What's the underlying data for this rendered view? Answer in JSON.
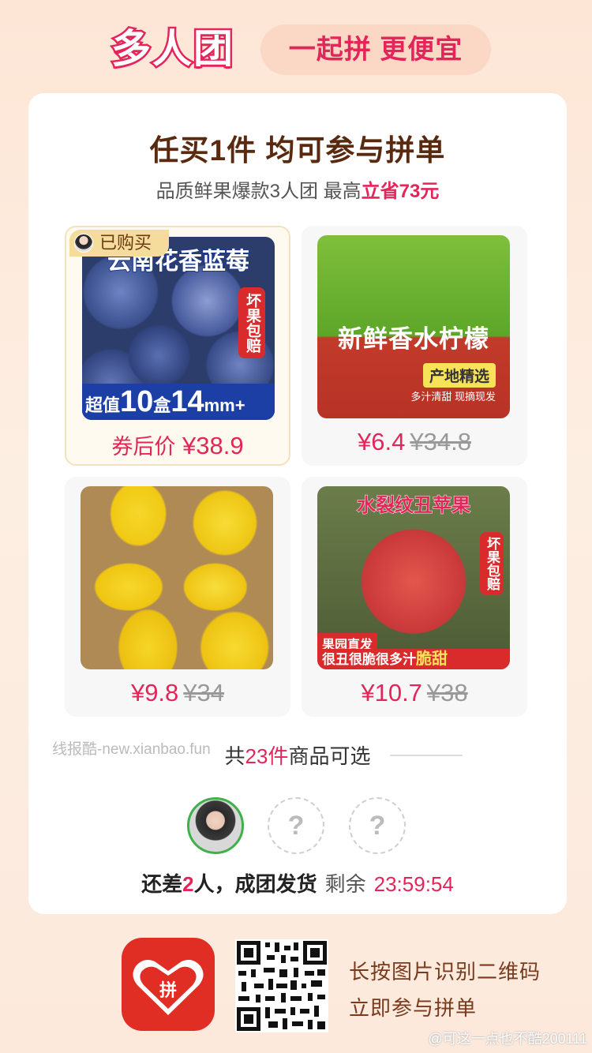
{
  "header": {
    "logo_text": "多人团",
    "slogan": "一起拼 更便宜"
  },
  "card": {
    "headline": "任买1件 均可参与拼单",
    "subline_prefix": "品质鲜果爆款3人团 最高",
    "subline_highlight": "立省73元"
  },
  "products": [
    {
      "bought_tag": "已购买",
      "image_title": "云南花香蓝莓",
      "image_badge": "坏果包赔",
      "image_bottom_a": "超值",
      "image_bottom_b": "10",
      "image_bottom_c": "盒",
      "image_bottom_d": "14",
      "image_bottom_e": "mm+",
      "price_prefix": "券后价",
      "price": "¥38.9",
      "old_price": ""
    },
    {
      "image_banner": "新鲜香水柠檬",
      "image_tag": "产地精选",
      "image_sub": "多汁清甜 现摘现发",
      "price": "¥6.4",
      "old_price": "¥34.8"
    },
    {
      "price": "¥9.8",
      "old_price": "¥34"
    },
    {
      "image_title": "水裂纹丑苹果",
      "image_badge": "坏果包赔",
      "image_strip1": "果园直发",
      "image_strip2": "很丑很脆很多汁",
      "image_strip2_hl": "脆甜",
      "price": "¥10.7",
      "old_price": "¥38"
    }
  ],
  "count": {
    "prefix": "共",
    "num": "23件",
    "suffix": "商品可选"
  },
  "watermark": "线报酷-new.xianbao.fun",
  "group": {
    "empty_slot_symbol": "?",
    "status_a": "还差",
    "status_num": "2",
    "status_b": "人，成团发货",
    "remaining_label": "剩余",
    "countdown": "23:59:54"
  },
  "footer": {
    "cta_line1": "长按图片识别二维码",
    "cta_line2": "立即参与拼单",
    "credit": "@可这一点也不酷200111",
    "logo_char": "拼"
  },
  "colors": {
    "accent": "#e4255a",
    "brand_red": "#e02e24",
    "headline_brown": "#5a2a10"
  }
}
